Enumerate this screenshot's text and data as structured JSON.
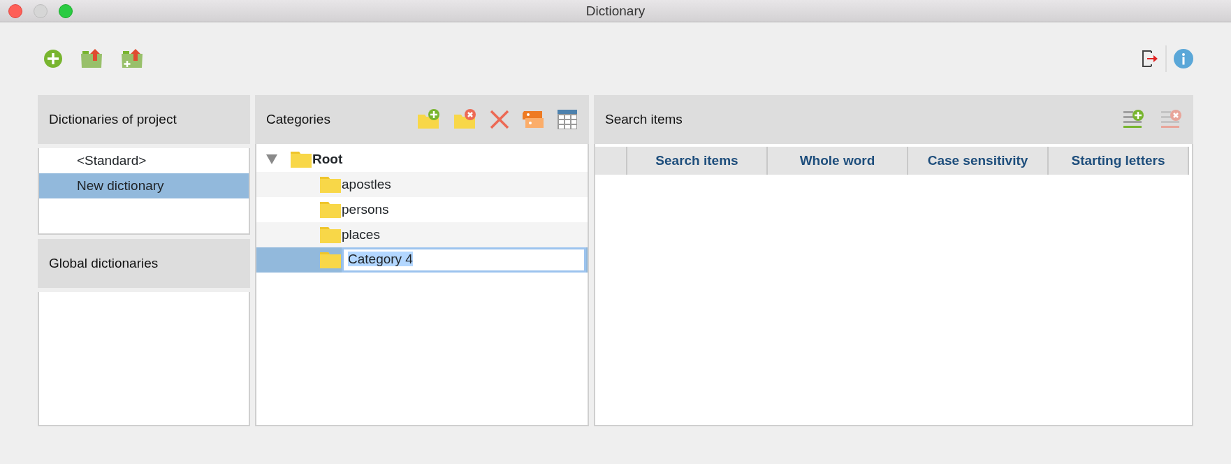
{
  "window": {
    "title": "Dictionary"
  },
  "dictionaries_of_project": {
    "title": "Dictionaries of project",
    "items": [
      {
        "label": "<Standard>",
        "selected": false
      },
      {
        "label": "New dictionary",
        "selected": true
      }
    ]
  },
  "global_dictionaries": {
    "title": "Global dictionaries"
  },
  "categories": {
    "title": "Categories",
    "tree": [
      {
        "label": "Root",
        "bold": true,
        "expanded": true,
        "selected": false,
        "children": [
          {
            "label": "apostles",
            "selected": false,
            "editing": false
          },
          {
            "label": "persons",
            "selected": false,
            "editing": false
          },
          {
            "label": "places",
            "selected": false,
            "editing": false
          },
          {
            "label": "Category 4",
            "selected": true,
            "editing": true
          }
        ]
      }
    ]
  },
  "search_items": {
    "title": "Search items",
    "table": {
      "columns": [
        "Search items",
        "Whole word",
        "Case sensitivity",
        "Starting letters"
      ]
    }
  }
}
